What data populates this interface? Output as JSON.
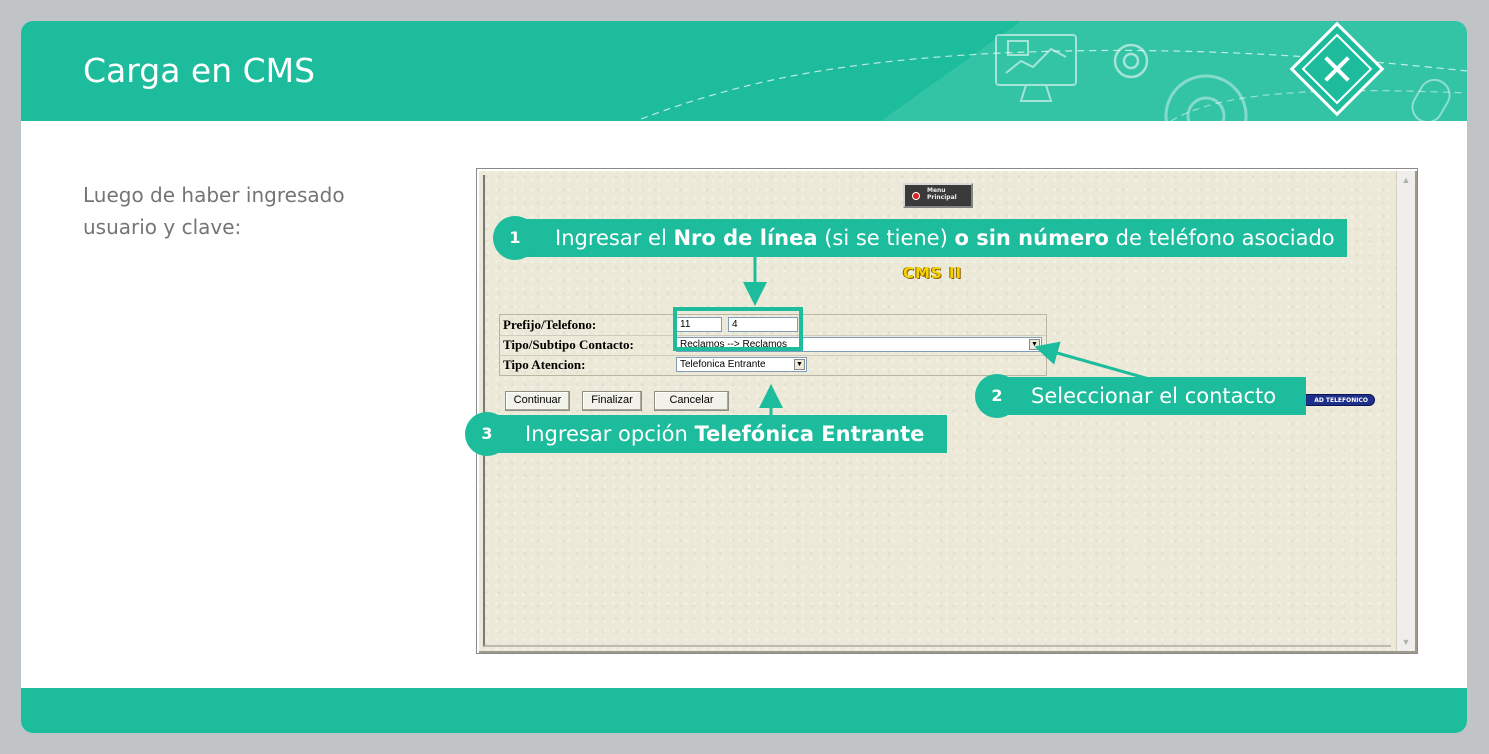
{
  "slide": {
    "title": "Carga en CMS",
    "intro_text": "Luego de haber ingresado\nusuario y clave:"
  },
  "app": {
    "menu_button": "Menu\nPrincipal",
    "logo": "CMS II",
    "form": {
      "prefijo_label": "Prefijo/Telefono:",
      "prefijo_value": "11",
      "telefono_value": "4",
      "tipo_contacto_label": "Tipo/Subtipo Contacto:",
      "tipo_contacto_value": "Reclamos --> Reclamos",
      "tipo_atencion_label": "Tipo Atencion:",
      "tipo_atencion_value": "Telefonica Entrante"
    },
    "buttons": {
      "continuar": "Continuar",
      "finalizar": "Finalizar",
      "cancelar": "Cancelar",
      "telefonico": "AD TELEFONICO"
    }
  },
  "callouts": [
    {
      "num": "1",
      "parts": [
        "Ingresar el ",
        "Nro de línea",
        " (si se tiene) ",
        "o sin número",
        " de teléfono asociado"
      ]
    },
    {
      "num": "2",
      "text": "Seleccionar el contacto"
    },
    {
      "num": "3",
      "parts": [
        "Ingresar opción ",
        "Telefónica Entrante"
      ]
    }
  ],
  "colors": {
    "accent": "#1cbc9c",
    "background": "#c1c4c7"
  }
}
